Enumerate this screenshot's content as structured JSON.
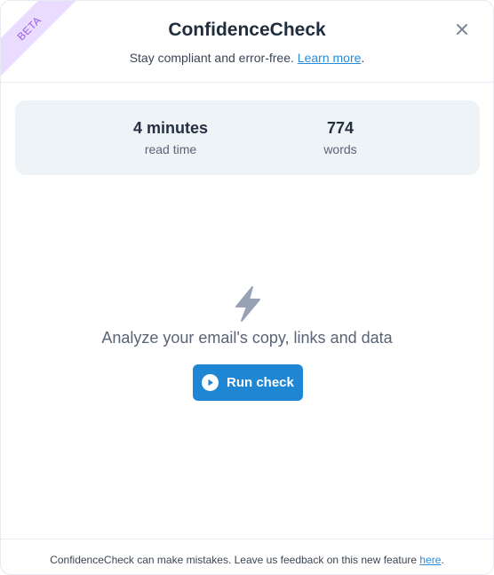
{
  "badge": {
    "label": "BETA"
  },
  "header": {
    "title": "ConfidenceCheck",
    "subtitle_prefix": "Stay compliant and error-free. ",
    "learn_more_label": "Learn more",
    "subtitle_suffix": "."
  },
  "stats": [
    {
      "value": "4 minutes",
      "label": "read time"
    },
    {
      "value": "774",
      "label": "words"
    }
  ],
  "empty_state": {
    "icon": "lightning-bolt-icon",
    "message": "Analyze your email's copy, links and data",
    "button_label": "Run check",
    "button_icon": "play-circle-icon"
  },
  "footer": {
    "text_prefix": "ConfidenceCheck can make mistakes. Leave us feedback on this new feature ",
    "link_label": "here",
    "text_suffix": "."
  },
  "colors": {
    "primary": "#1f86d4",
    "link": "#2a8bd8",
    "badge_bg": "#eadcff",
    "badge_text": "#9b5ce8",
    "stats_bg": "#eef3f8",
    "muted_icon": "#97a3b4"
  }
}
